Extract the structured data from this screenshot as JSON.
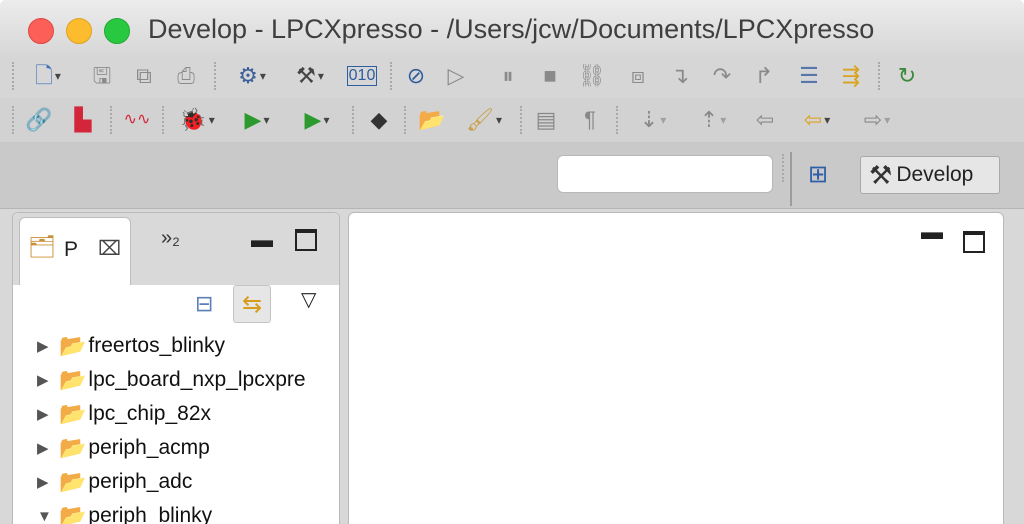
{
  "window": {
    "title": "Develop - LPCXpresso - /Users/jcw/Documents/LPCXpresso"
  },
  "toolbar": {
    "search_value": "",
    "search_placeholder": "",
    "perspective_label": "Develop"
  },
  "project_explorer": {
    "tab_label": "P",
    "tab_close_glyph": "⌧",
    "overflow_tab_label": "»₂",
    "projects": [
      {
        "name": "freertos_blinky",
        "expanded": false
      },
      {
        "name": "lpc_board_nxp_lpcxpre",
        "expanded": false
      },
      {
        "name": "lpc_chip_82x",
        "expanded": false
      },
      {
        "name": "periph_acmp",
        "expanded": false
      },
      {
        "name": "periph_adc",
        "expanded": false
      },
      {
        "name": "periph_blinky",
        "expanded": true
      }
    ]
  },
  "colors": {
    "close": "#fc5f57",
    "minimize": "#fdbc2e",
    "maximize": "#28c840",
    "folder": "#e1a73a"
  }
}
